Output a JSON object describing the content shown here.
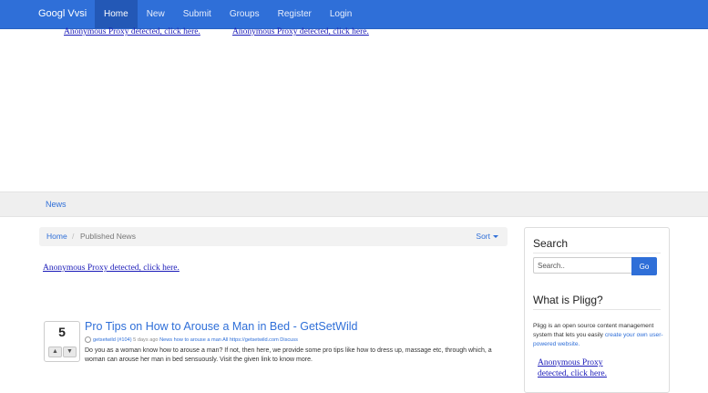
{
  "navbar": {
    "brand": "Googl Vvsi",
    "items": [
      {
        "label": "Home",
        "active": true
      },
      {
        "label": "New"
      },
      {
        "label": "Submit"
      },
      {
        "label": "Groups"
      },
      {
        "label": "Register"
      },
      {
        "label": "Login"
      }
    ]
  },
  "proxy_notices": {
    "top_left": "Anonymous Proxy detected, click here.",
    "top_right": "Anonymous Proxy detected, click here.",
    "main": "Anonymous Proxy detected, click here.",
    "sidebar_line1": "Anonymous Proxy",
    "sidebar_line2": "detected, click here."
  },
  "subnav": {
    "news_label": "News"
  },
  "breadcrumb": {
    "home": "Home",
    "separator": "/",
    "current": "Published News",
    "sort_label": "Sort"
  },
  "story": {
    "votes": "5",
    "title": "Pro Tips on How to Arouse a Man in Bed - GetSetWild",
    "meta": {
      "author": "getsetwild (#104)",
      "age": "5 days ago",
      "category": "News",
      "tags": "how to arouse a man All",
      "url": "https://getsetwild.com",
      "discuss": "Discuss"
    },
    "description": "Do you as a woman know how to arouse a man? If not, then here, we provide some pro tips like how to dress up, massage etc, through which, a woman can arouse her man in bed sensuously. Visit the given link to know more."
  },
  "sidebar": {
    "search_heading": "Search",
    "search_placeholder": "Search..",
    "go_label": "Go",
    "what_heading": "What is Pligg?",
    "what_text": "Pligg is an open source content management system that lets you easily",
    "what_link": "create your own user-powered website."
  },
  "colors": {
    "accent": "#2f6fd8",
    "proxy_link": "#1a1ab8"
  }
}
